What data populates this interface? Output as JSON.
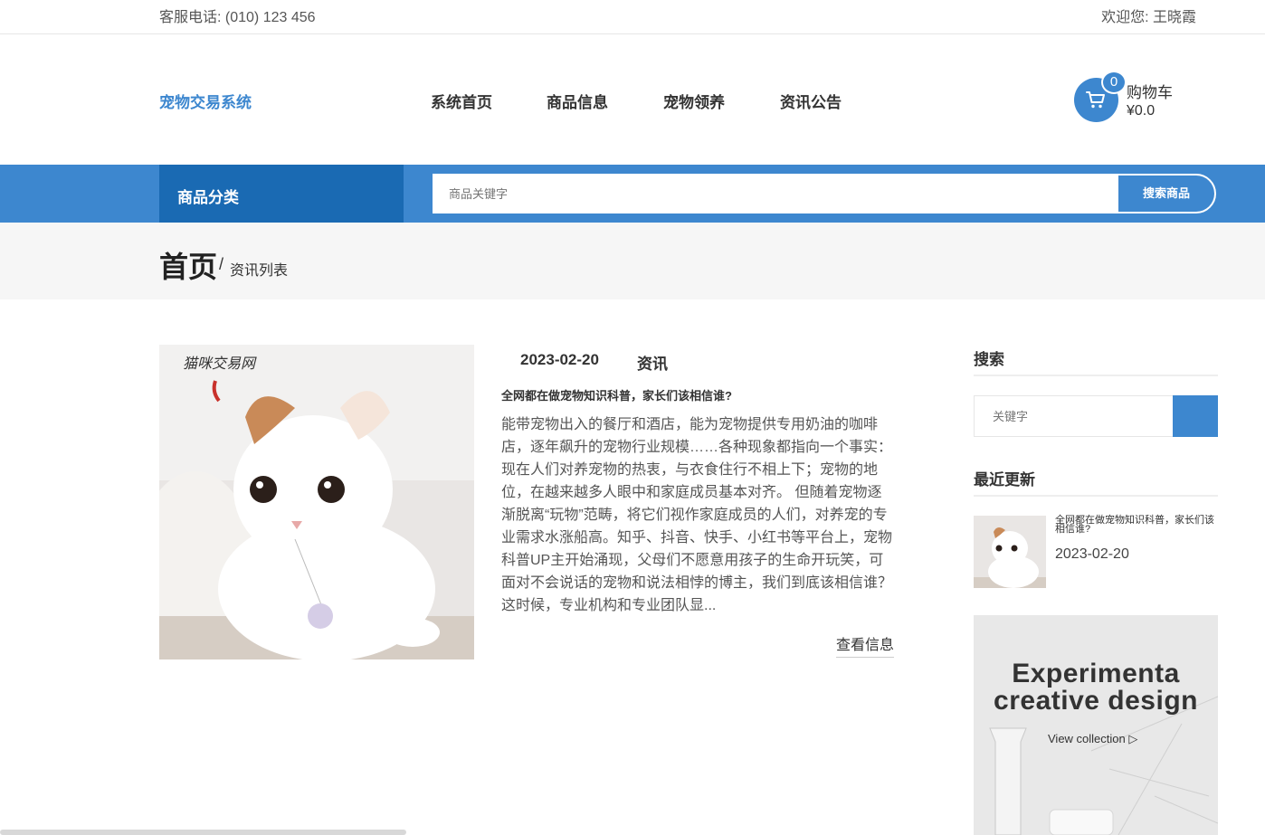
{
  "topbar": {
    "phone": "客服电话: (010) 123 456",
    "welcome": "欢迎您: 王晓霞"
  },
  "header": {
    "logo": "宠物交易系统",
    "nav": [
      "系统首页",
      "商品信息",
      "宠物领养",
      "资讯公告"
    ],
    "cart": {
      "count": "0",
      "label": "购物车",
      "price": "¥0.0"
    }
  },
  "searchbar": {
    "category": "商品分类",
    "placeholder": "商品关键字",
    "button": "搜索商品"
  },
  "breadcrumb": {
    "home": "首页",
    "sep": "/",
    "current": "资讯列表"
  },
  "article": {
    "date": "2023-02-20",
    "category": "资讯",
    "title": "全网都在做宠物知识科普，家长们该相信谁?",
    "excerpt": "能带宠物出入的餐厅和酒店，能为宠物提供专用奶油的咖啡店，逐年飙升的宠物行业规模……各种现象都指向一个事实：现在人们对养宠物的热衷，与衣食住行不相上下；宠物的地位，在越来越多人眼中和家庭成员基本对齐。 但随着宠物逐渐脱离“玩物”范畴，将它们视作家庭成员的人们，对养宠的专业需求水涨船高。知乎、抖音、快手、小红书等平台上，宠物科普UP主开始涌现，父母们不愿意用孩子的生命开玩笑，可面对不会说话的宠物和说法相悖的博主，我们到底该相信谁？这时候，专业机构和专业团队显...",
    "read_more": "查看信息",
    "image_watermark": "猫咪交易网"
  },
  "sidebar": {
    "search_heading": "搜索",
    "search_placeholder": "关键字",
    "recent_heading": "最近更新",
    "recent": [
      {
        "title": "全网都在做宠物知识科普，家长们该相信谁?",
        "date": "2023-02-20"
      }
    ],
    "banner": {
      "line1": "Experimenta",
      "line2": "creative design",
      "link": "View collection ▷"
    }
  },
  "colors": {
    "accent": "#3d87cf",
    "accent_dark": "#1a6ab3"
  }
}
